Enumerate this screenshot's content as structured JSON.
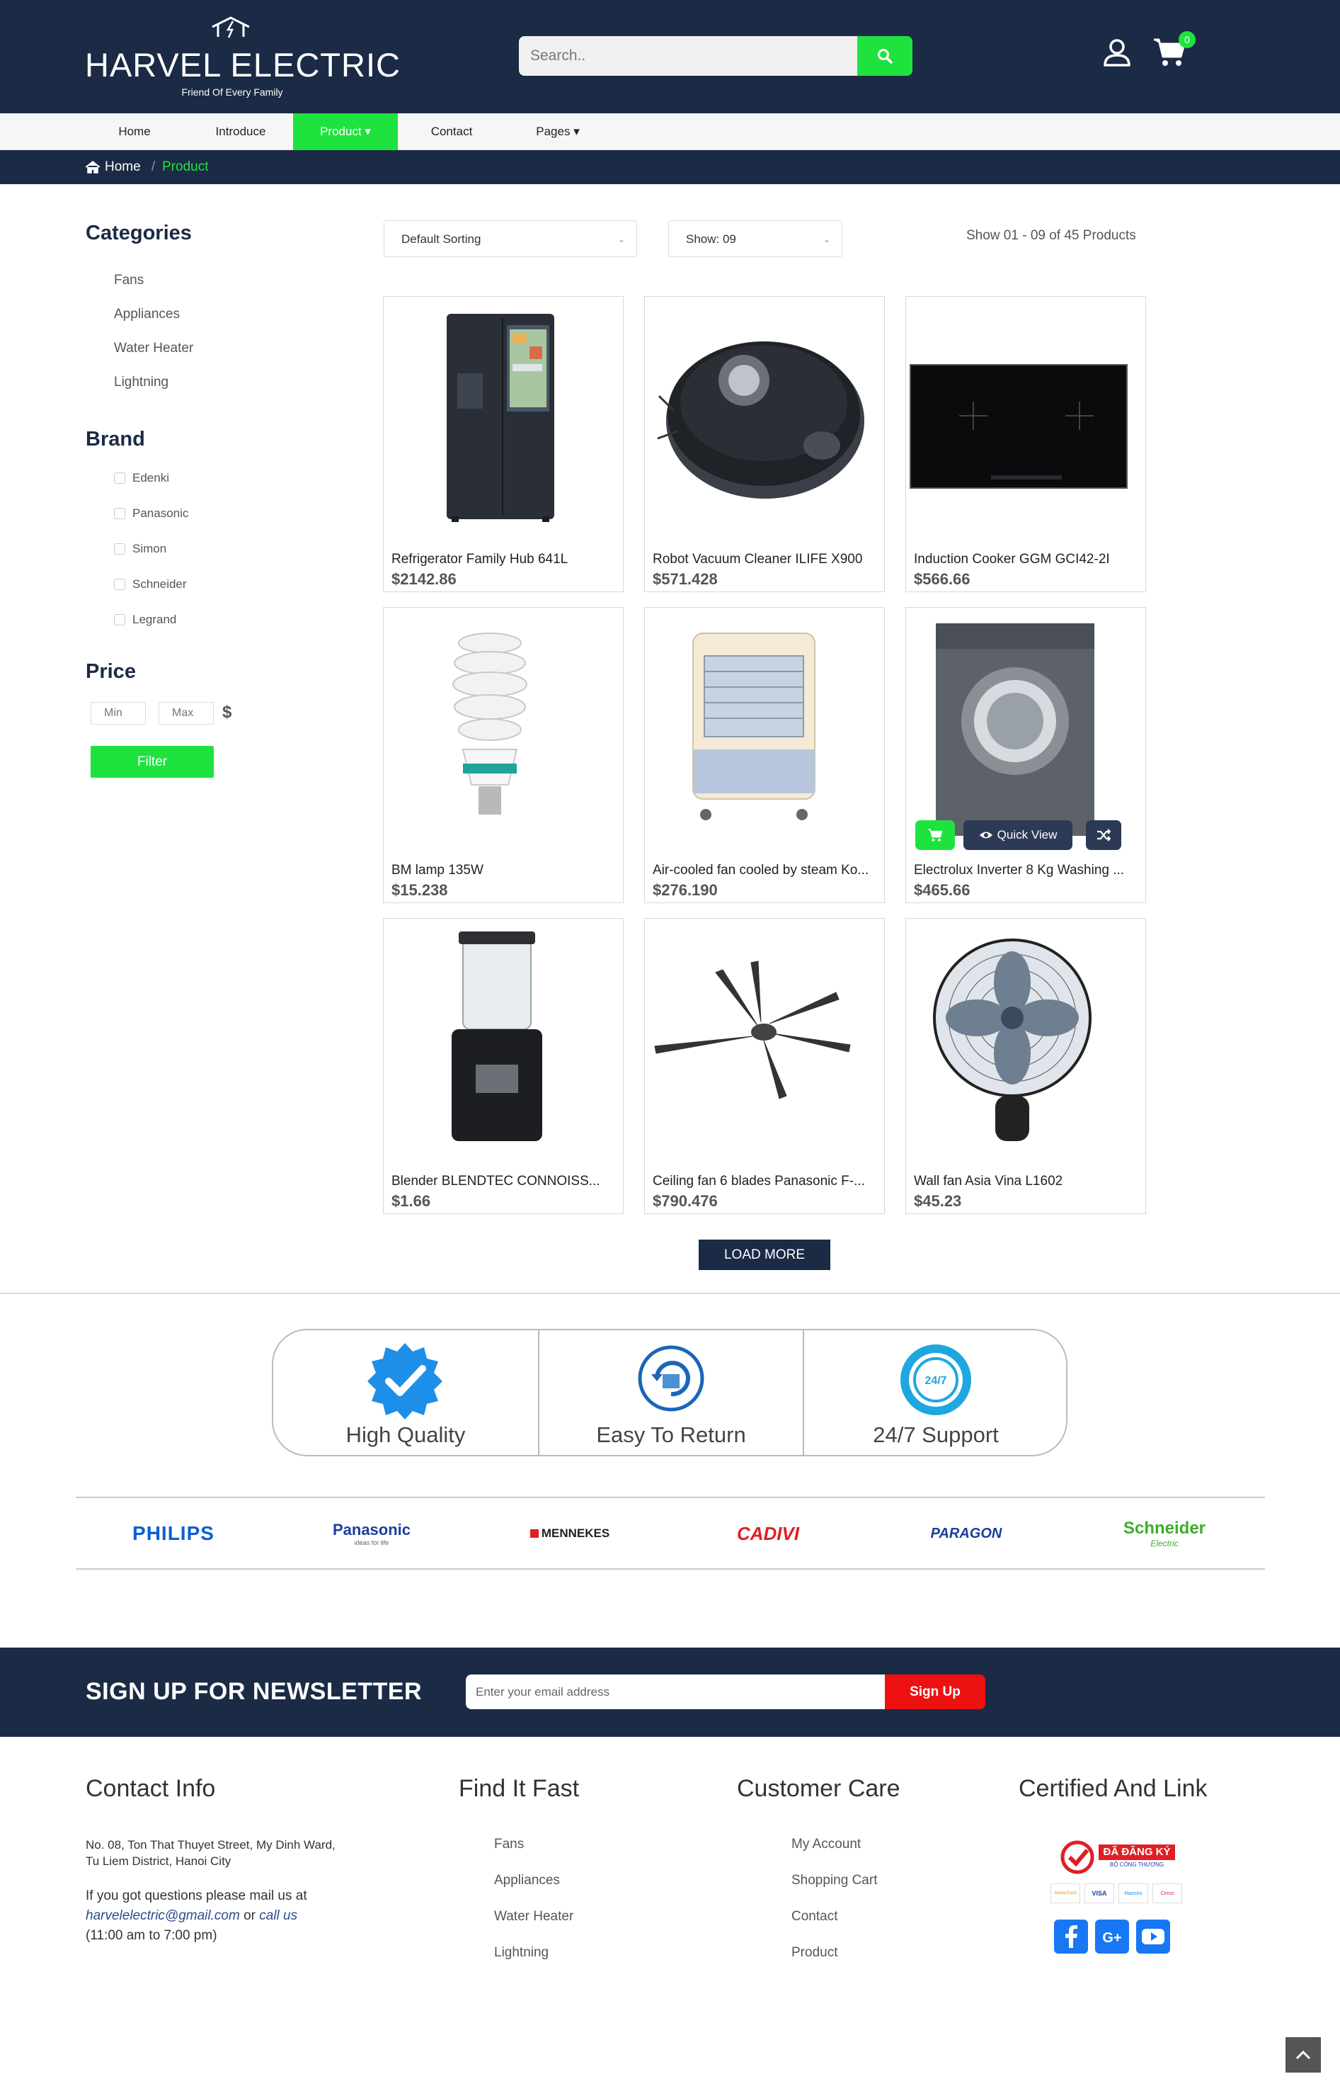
{
  "header": {
    "logo_title": "HARVEL ELECTRIC",
    "logo_tagline": "Friend Of Every Family",
    "search_placeholder": "Search..",
    "cart_count": "0"
  },
  "nav": {
    "items": [
      {
        "label": "Home"
      },
      {
        "label": "Introduce"
      },
      {
        "label": "Product ▾"
      },
      {
        "label": "Contact"
      },
      {
        "label": "Pages ▾"
      }
    ]
  },
  "breadcrumb": {
    "home": "Home",
    "separator": "/",
    "current": "Product"
  },
  "sidebar": {
    "categories_title": "Categories",
    "categories": [
      "Fans",
      "Appliances",
      "Water Heater",
      "Lightning"
    ],
    "brand_title": "Brand",
    "brands": [
      "Edenki",
      "Panasonic",
      "Simon",
      "Schneider",
      "Legrand"
    ],
    "price_title": "Price",
    "price_min_placeholder": "Min",
    "price_max_placeholder": "Max",
    "currency": "$",
    "filter_label": "Filter"
  },
  "toolbar": {
    "sort_selected": "Default Sorting",
    "show_selected": "Show: 09",
    "result_count": "Show 01 - 09 of 45 Products"
  },
  "products": [
    {
      "name": "Refrigerator Family Hub 641L",
      "price": "$2142.86"
    },
    {
      "name": "Robot Vacuum Cleaner ILIFE X900",
      "price": "$571.428"
    },
    {
      "name": "Induction Cooker GGM GCI42-2I",
      "price": "$566.66"
    },
    {
      "name": "BM lamp 135W",
      "price": "$15.238"
    },
    {
      "name": "Air-cooled fan cooled by steam Ko...",
      "price": "$276.190"
    },
    {
      "name": "Electrolux Inverter 8 Kg Washing ...",
      "price": "$465.66"
    },
    {
      "name": "Blender BLENDTEC CONNOISS...",
      "price": "$1.66"
    },
    {
      "name": "Ceiling fan 6 blades Panasonic F-...",
      "price": "$790.476"
    },
    {
      "name": "Wall fan Asia Vina L1602",
      "price": "$45.23"
    }
  ],
  "quick_view_label": "Quick View",
  "load_more_label": "LOAD MORE",
  "features": [
    {
      "label": "High Quality"
    },
    {
      "label": "Easy To Return"
    },
    {
      "label": "24/7 Support"
    }
  ],
  "brand_logos": [
    {
      "name": "PHILIPS",
      "color": "#0b5ed7"
    },
    {
      "name": "Panasonic",
      "sub": "ideas for life",
      "color": "#1a3f9c"
    },
    {
      "name": "MENNEKES",
      "color": "#222222"
    },
    {
      "name": "CADIVI",
      "color": "#e01e24"
    },
    {
      "name": "PARAGON",
      "color": "#1a3f9c"
    },
    {
      "name": "Schneider",
      "sub": "Electric",
      "color": "#3dae2b"
    }
  ],
  "newsletter": {
    "title": "SIGN UP FOR NEWSLETTER",
    "placeholder": "Enter your email address",
    "button": "Sign Up"
  },
  "footer": {
    "contact_title": "Contact Info",
    "address_line1": "No. 08, Ton That Thuyet Street, My Dinh Ward,",
    "address_line2": "Tu Liem District, Hanoi City",
    "mail_prefix": "If you got questions please mail us at",
    "email": "harvelelectric@gmail.com",
    "mail_or": " or ",
    "call_us": "call us",
    "hours": "(11:00 am to 7:00 pm)",
    "find_title": "Find It Fast",
    "find_links": [
      "Fans",
      "Appliances",
      "Water Heater",
      "Lightning"
    ],
    "care_title": "Customer Care",
    "care_links": [
      "My Account",
      "Shopping Cart",
      "Contact",
      "Product"
    ],
    "cert_title": "Certified And Link",
    "cert_badge": "ĐÃ ĐĂNG KÝ",
    "cert_badge_sub": "BỘ CÔNG THƯƠNG",
    "payment_cards": [
      "MasterCard",
      "VISA",
      "Maestro",
      "Cirrus"
    ]
  },
  "colors": {
    "navy": "#1b2a45",
    "accent_green": "#1ee33e",
    "signup_red": "#ee1111"
  }
}
